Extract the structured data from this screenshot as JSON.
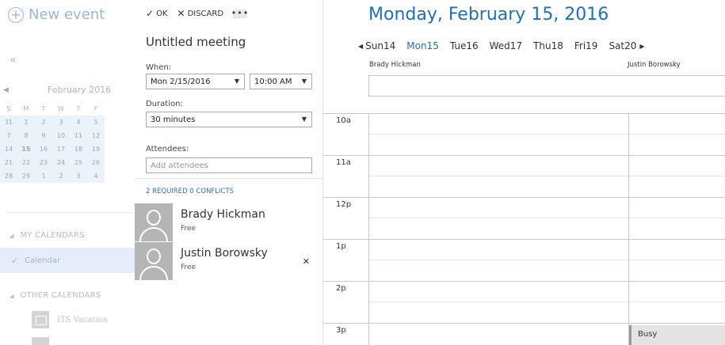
{
  "nav": {
    "new_event": "New event",
    "collapse_glyph": "«",
    "mini_calendar": {
      "month_label": "February 2016",
      "weekdays": [
        "S",
        "M",
        "T",
        "W",
        "T",
        "F"
      ],
      "weeks": [
        [
          "31",
          "1",
          "2",
          "3",
          "4",
          "5"
        ],
        [
          "7",
          "8",
          "9",
          "10",
          "11",
          "12"
        ],
        [
          "14",
          "15",
          "16",
          "17",
          "18",
          "19"
        ],
        [
          "21",
          "22",
          "23",
          "24",
          "25",
          "26"
        ],
        [
          "28",
          "29",
          "1",
          "2",
          "3",
          "4"
        ]
      ],
      "selected_day": "15"
    },
    "my_calendars_label": "MY CALENDARS",
    "calendar_item": "Calendar",
    "other_calendars_label": "OTHER CALENDARS",
    "other_item": "ITS Vacation"
  },
  "compose": {
    "ok_label": "OK",
    "discard_label": "DISCARD",
    "more_label": "•••",
    "subject": "Untitled meeting",
    "when_label": "When:",
    "date_value": "Mon 2/15/2016",
    "time_value": "10:00 AM",
    "duration_label": "Duration:",
    "duration_value": "30 minutes",
    "attendees_label": "Attendees:",
    "attendees_placeholder": "Add attendees",
    "conflicts_text": "2 REQUIRED 0 CONFLICTS",
    "attendees": [
      {
        "name": "Brady Hickman",
        "status": "Free"
      },
      {
        "name": "Justin Borowsky",
        "status": "Free"
      }
    ]
  },
  "schedule": {
    "title": "Monday, February 15, 2016",
    "days": [
      "Sun14",
      "Mon15",
      "Tue16",
      "Wed17",
      "Thu18",
      "Fri19",
      "Sat20"
    ],
    "selected_day_index": 1,
    "people": [
      "Brady Hickman",
      "Justin Borowsky"
    ],
    "hours": [
      "10a",
      "11a",
      "12p",
      "1p",
      "2p",
      "3p"
    ],
    "busy_label": "Busy"
  },
  "colors": {
    "accent": "#1f6fb9",
    "selection": "#e5eef8",
    "busy": "#e3e3e3"
  }
}
